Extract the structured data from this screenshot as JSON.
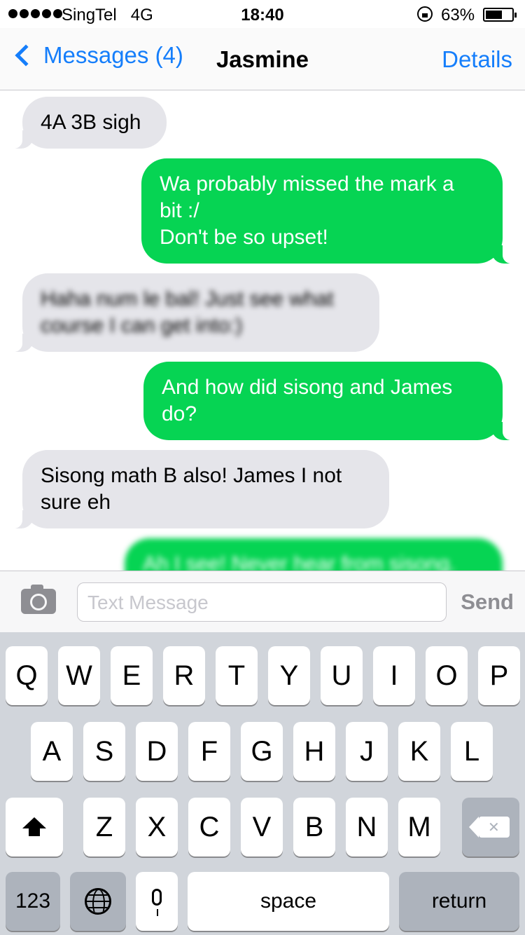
{
  "status_bar": {
    "carrier": "SingTel",
    "network": "4G",
    "time": "18:40",
    "battery": "63%",
    "battery_level": 0.63
  },
  "nav": {
    "back_label": "Messages (4)",
    "title": "Jasmine",
    "details_label": "Details"
  },
  "messages": [
    {
      "direction": "incoming",
      "text": "4A 3B sigh"
    },
    {
      "direction": "outgoing",
      "lines": [
        "Wa probably missed the mark a",
        "bit :/",
        "Don't be so upset!"
      ]
    },
    {
      "direction": "incoming",
      "blurred": true,
      "lines": [
        "Haha num le bal! Just see what",
        "course I can get into:)"
      ]
    },
    {
      "direction": "outgoing",
      "lines": [
        "And how did sisong and James",
        "do?"
      ]
    },
    {
      "direction": "incoming",
      "lines": [
        "Sisong math B also! James I not",
        "sure eh"
      ]
    },
    {
      "direction": "outgoing",
      "blurred": true,
      "text": "Ah I see! Never hear from sisong."
    }
  ],
  "input": {
    "placeholder": "Text Message",
    "send_label": "Send"
  },
  "keyboard": {
    "row1": [
      "Q",
      "W",
      "E",
      "R",
      "T",
      "Y",
      "U",
      "I",
      "O",
      "P"
    ],
    "row2": [
      "A",
      "S",
      "D",
      "F",
      "G",
      "H",
      "J",
      "K",
      "L"
    ],
    "row3": [
      "Z",
      "X",
      "C",
      "V",
      "B",
      "N",
      "M"
    ],
    "numbers_label": "123",
    "space_label": "space",
    "return_label": "return"
  }
}
